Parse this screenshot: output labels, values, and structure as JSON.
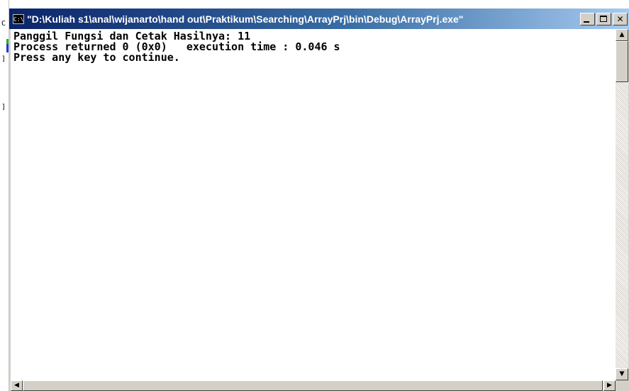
{
  "window": {
    "title": "\"D:\\Kuliah s1\\anal\\wijanarto\\hand out\\Praktikum\\Searching\\ArrayPrj\\bin\\Debug\\ArrayPrj.exe\"",
    "icon": "console-icon",
    "icon_label": "C:\\",
    "controls": {
      "minimize": "minimize-icon",
      "maximize": "maximize-icon",
      "close": "close-icon",
      "close_glyph": "✕"
    }
  },
  "console": {
    "lines": [
      "Panggil Fungsi dan Cetak Hasilnya: 11",
      "Process returned 0 (0x0)   execution time : 0.046 s",
      "Press any key to continue."
    ]
  },
  "scrollbars": {
    "up_glyph": "▲",
    "down_glyph": "▼",
    "left_glyph": "◀",
    "right_glyph": "▶"
  },
  "background": {
    "marks": [
      "C",
      "]",
      "]"
    ]
  },
  "colors": {
    "title_gradient_start": "#0a246a",
    "title_gradient_end": "#a6caf0",
    "console_bg": "#ffffff",
    "console_text": "#000000",
    "chrome": "#d4d0c8"
  }
}
